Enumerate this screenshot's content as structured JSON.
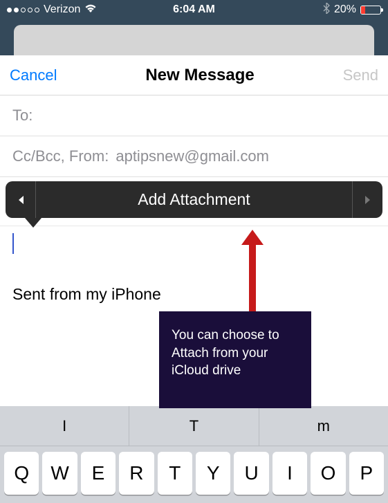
{
  "statusbar": {
    "carrier": "Verizon",
    "time": "6:04 AM",
    "battery_pct": "20%",
    "battery_level": 0.2
  },
  "nav": {
    "cancel": "Cancel",
    "title": "New Message",
    "send": "Send"
  },
  "fields": {
    "to_label": "To:",
    "ccbcc_label": "Cc/Bcc, From:",
    "from_value": "aptipsnew@gmail.com"
  },
  "popup": {
    "label": "Add Attachment"
  },
  "body": {
    "signature": "Sent from my iPhone"
  },
  "annotation": {
    "text": "You can choose to Attach from your iCloud drive"
  },
  "keyboard": {
    "predictions": [
      "I",
      "T",
      "m"
    ],
    "row1": [
      "Q",
      "W",
      "E",
      "R",
      "T",
      "Y",
      "U",
      "I",
      "O",
      "P"
    ]
  }
}
